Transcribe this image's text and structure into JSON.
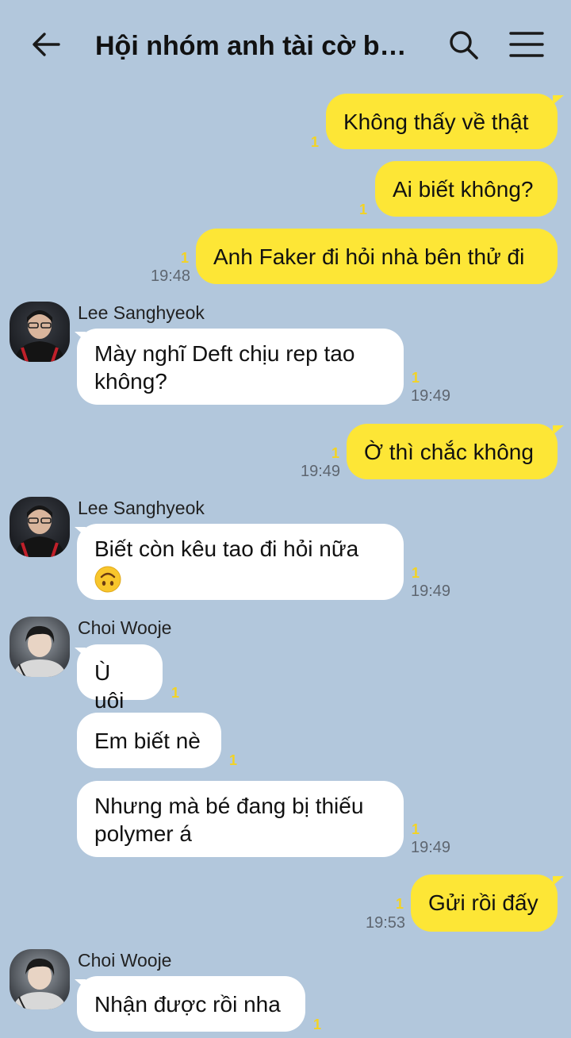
{
  "header": {
    "title": "Hội nhóm anh tài cờ bạ...",
    "back_icon": "arrow-left-icon",
    "search_icon": "search-icon",
    "menu_icon": "hamburger-menu-icon"
  },
  "messages": [
    {
      "text": "Không thấy về thật",
      "unread": "1"
    },
    {
      "text": "Ai biết không?",
      "unread": "1"
    },
    {
      "text": "Anh Faker đi hỏi nhà bên thử đi",
      "unread": "1",
      "time": "19:48"
    },
    {
      "sender": "Lee Sanghyeok",
      "line1": "Mày nghĩ Deft chịu rep tao",
      "line2": "không?",
      "unread": "1",
      "time": "19:49"
    },
    {
      "text": "Ờ thì chắc không",
      "unread": "1",
      "time": "19:49"
    },
    {
      "sender": "Lee Sanghyeok",
      "line1": "Biết còn kêu tao đi hỏi nữa",
      "emoji": "upside-down-face-emoji",
      "unread": "1",
      "time": "19:49"
    },
    {
      "sender": "Choi Wooje",
      "text": "Ù uôi",
      "unread": "1"
    },
    {
      "text": "Em biết nè",
      "unread": "1"
    },
    {
      "line1": "Nhưng mà bé đang bị thiếu",
      "line2": "polymer á",
      "unread": "1",
      "time": "19:49"
    },
    {
      "text": "Gửi rồi đấy",
      "unread": "1",
      "time": "19:53"
    },
    {
      "sender": "Choi Wooje",
      "text": "Nhận được rồi nha",
      "unread": "1"
    }
  ],
  "colors": {
    "background": "#b2c7dc",
    "outgoing_bubble": "#fde636",
    "incoming_bubble": "#ffffff",
    "unread_count": "#f3d323",
    "timestamp": "#5e6670"
  }
}
